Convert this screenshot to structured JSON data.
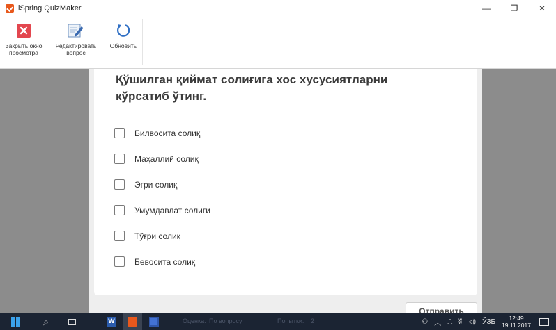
{
  "window": {
    "title": "iSpring QuizMaker",
    "controls": {
      "minimize": "—",
      "maximize": "❐",
      "close": "✕"
    }
  },
  "ribbon": {
    "buttons": [
      {
        "label": "Закрыть окно\nпросмотра",
        "icon": "close-icon"
      },
      {
        "label": "Редактировать\nвопрос",
        "icon": "edit-icon"
      },
      {
        "label": "Обновить",
        "icon": "refresh-icon"
      }
    ]
  },
  "quiz": {
    "question": "Қўшилган қиймат солиғига хос хусусиятларни кўрсатиб ўтинг.",
    "options": [
      "Билвосита солиқ",
      "Маҳаллий солиқ",
      "Эгри солиқ",
      "Умумдавлат солиғи",
      "Тўғри солиқ",
      "Бевосита солиқ"
    ],
    "submit": "Отправить"
  },
  "taskbar": {
    "faint_items": [
      "Оценка:",
      "По вопросу",
      "Попытки:",
      "2"
    ],
    "tray_lang": "ЎЗБ",
    "time": "12:49",
    "date": "19.11.2017",
    "colors": {
      "bar": "#1b2433",
      "accent": "#e8581c"
    }
  }
}
